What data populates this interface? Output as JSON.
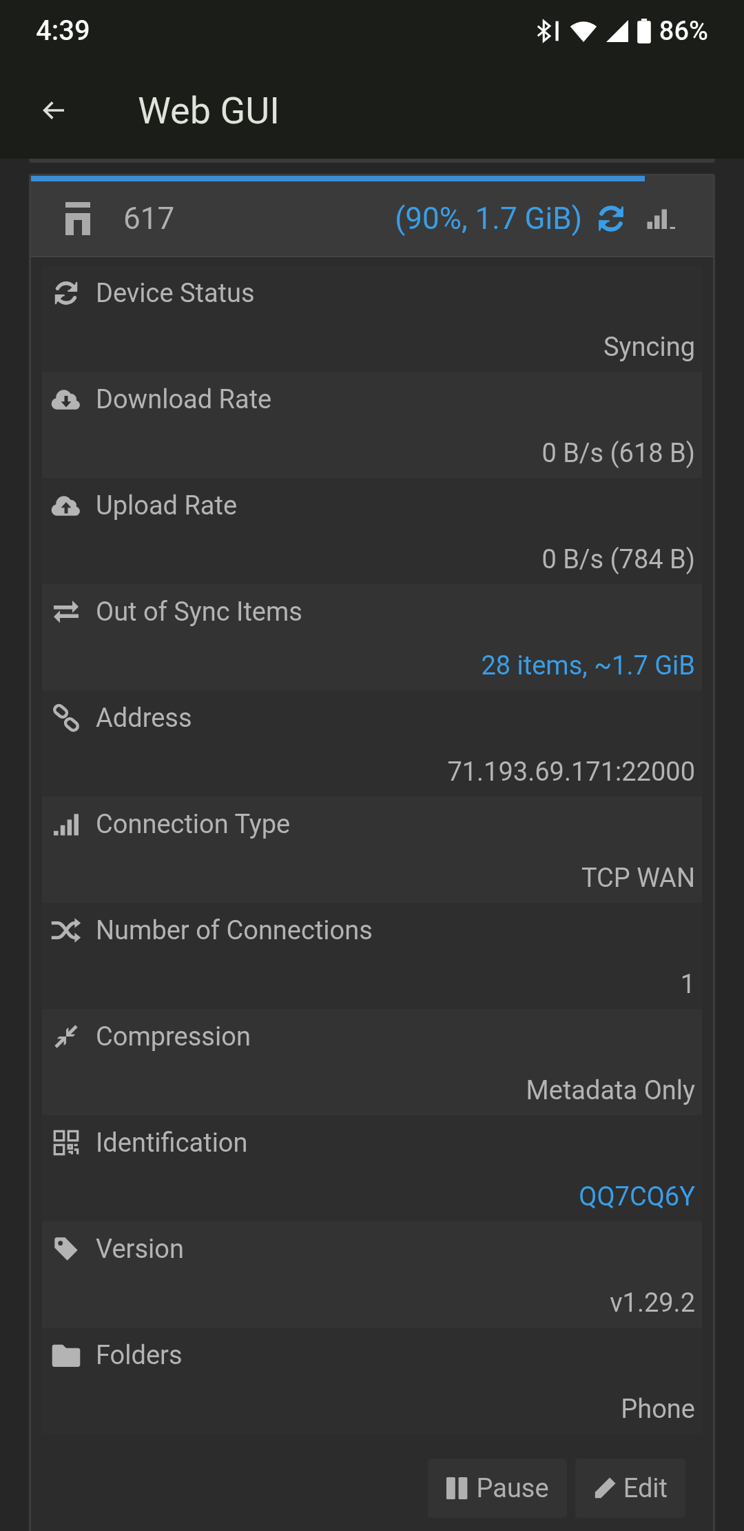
{
  "status_bar": {
    "time": "4:39",
    "battery": "86%"
  },
  "app_bar": {
    "title": "Web GUI"
  },
  "device": {
    "name": "617",
    "progress": {
      "level": 0.9
    },
    "sync_summary": "(90%, 1.7 GiB)",
    "rows": [
      {
        "label": "Device Status",
        "value": "Syncing",
        "highlighted": false
      },
      {
        "label": "Download Rate",
        "value": "0 B/s (618 B)",
        "highlighted": false
      },
      {
        "label": "Upload Rate",
        "value": "0 B/s (784 B)",
        "highlighted": false
      },
      {
        "label": "Out of Sync Items",
        "value": "28 items, ~1.7 GiB",
        "highlighted": true
      },
      {
        "label": "Address",
        "value": "71.193.69.171:22000",
        "highlighted": false
      },
      {
        "label": "Connection Type",
        "value": "TCP WAN",
        "highlighted": false
      },
      {
        "label": "Number of Connections",
        "value": "1",
        "highlighted": false
      },
      {
        "label": "Compression",
        "value": "Metadata Only",
        "highlighted": false
      },
      {
        "label": "Identification",
        "value": "QQ7CQ6Y",
        "highlighted": true
      },
      {
        "label": "Version",
        "value": "v1.29.2",
        "highlighted": false
      },
      {
        "label": "Folders",
        "value": "Phone",
        "highlighted": false
      }
    ],
    "buttons": [
      {
        "label": "Pause"
      },
      {
        "label": "Edit"
      }
    ]
  }
}
